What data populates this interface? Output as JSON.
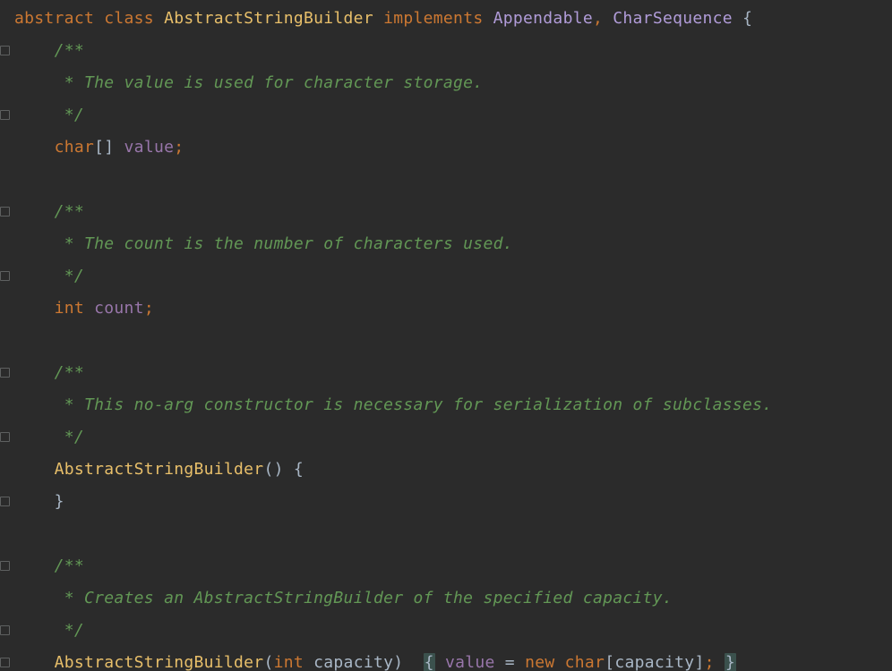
{
  "colors": {
    "background": "#2b2b2b",
    "keyword": "#cc7832",
    "type": "#e8bf6a",
    "identifier": "#b19cd9",
    "field": "#9876aa",
    "comment": "#629755",
    "text": "#a9b7c6",
    "braceHighlight": "#3b514d"
  },
  "code": {
    "indent": "    ",
    "kw_abstract": "abstract",
    "kw_class": "class",
    "class_name": "AbstractStringBuilder",
    "kw_implements": "implements",
    "iface1": "Appendable",
    "comma": ",",
    "iface2": "CharSequence",
    "obrace": "{",
    "cbrace": "}",
    "jd_open": "/**",
    "jd_close": " */",
    "jd_value": " * The value is used for character storage.",
    "type_char": "char",
    "brackets": "[]",
    "field_value": "value",
    "semi": ";",
    "jd_count": " * The count is the number of characters used.",
    "type_int": "int",
    "field_count": "count",
    "jd_ctor0": " * This no-arg constructor is necessary for serialization of subclasses.",
    "ctor_name": "AbstractStringBuilder",
    "parens_empty": "()",
    "jd_ctor1": " * Creates an AbstractStringBuilder of the specified capacity.",
    "oparen": "(",
    "cparen": ")",
    "param_capacity": "capacity",
    "assign": " = ",
    "kw_new": "new",
    "obracket": "[",
    "cbracket": "]"
  }
}
